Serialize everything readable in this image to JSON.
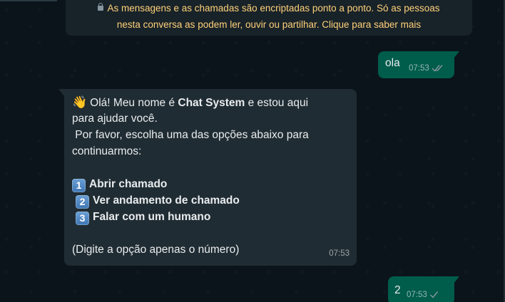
{
  "notice": {
    "icon": "lock-icon",
    "line1": "As mensagens e as chamadas são encriptadas ponto a ponto. Só as pessoas",
    "line2": "nesta conversa as podem ler, ouvir ou partilhar. Clique para saber mais",
    "color": "#ffd279"
  },
  "messages": {
    "ola": {
      "text": "ola",
      "time": "07:53",
      "status": "double-check-icon"
    },
    "bot": {
      "wave": "👋",
      "greeting_before": "Olá! Meu nome é ",
      "bot_name": "Chat System",
      "greeting_after": " e estou aqui",
      "line2": "para ajudar você.",
      "line3": " Por favor, escolha uma das opções abaixo para",
      "line4": "continuarmos:",
      "options": [
        {
          "key": "1",
          "label": "Abrir chamado"
        },
        {
          "key": "2",
          "label": "Ver andamento de chamado"
        },
        {
          "key": "3",
          "label": "Falar com um humano"
        }
      ],
      "footer": "(Digite a opção apenas o número)",
      "time": "07:53"
    },
    "two": {
      "text": "2",
      "time": "07:53",
      "status": "single-check-icon"
    }
  },
  "colors": {
    "outgoing_bubble": "#005c4b",
    "incoming_bubble": "#202c33",
    "background": "#0b141a"
  }
}
